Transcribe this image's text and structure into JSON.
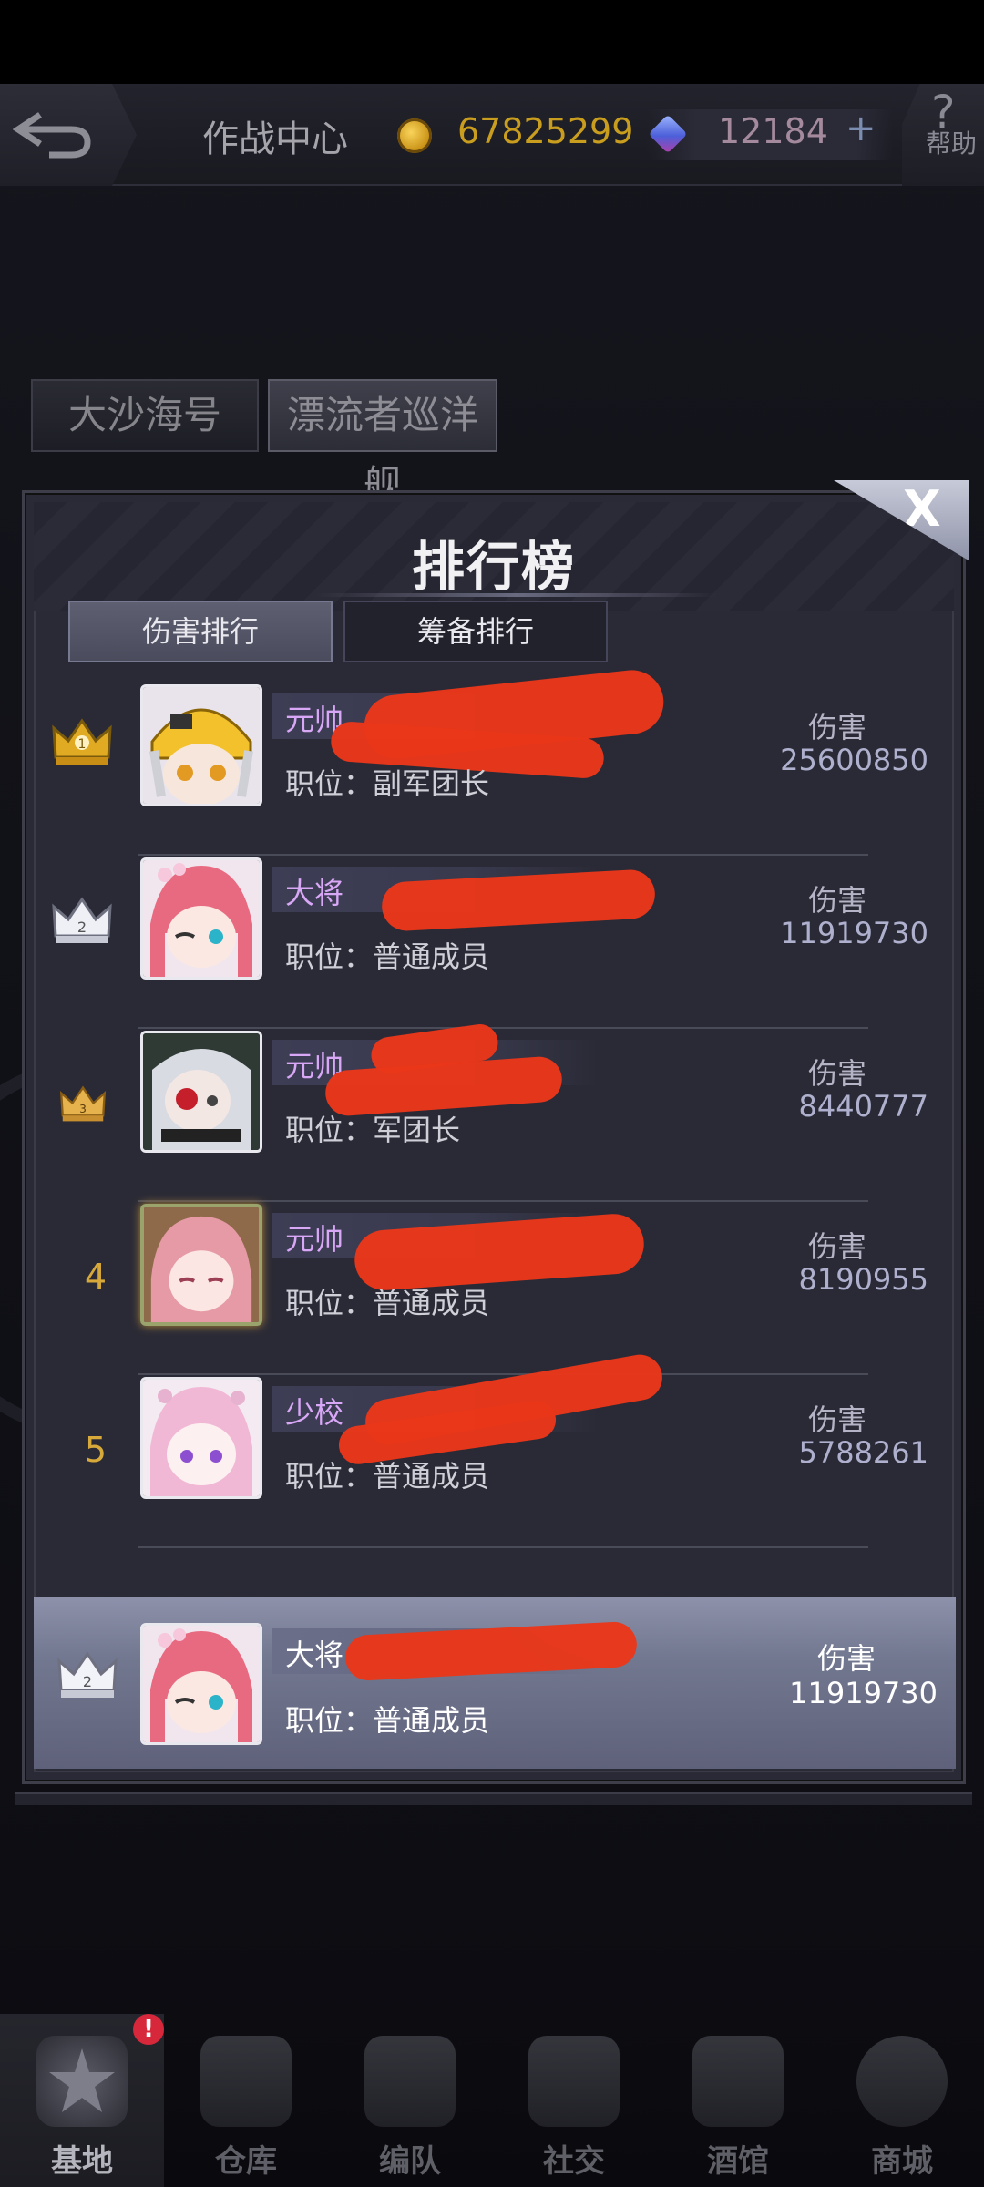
{
  "topbar": {
    "title": "作战中心",
    "gold": "67825299",
    "gems": "12184",
    "plus": "+",
    "help_q": "?",
    "help_label": "帮助"
  },
  "ship_tabs": [
    "大沙海号",
    "漂流者巡洋舰"
  ],
  "modal": {
    "title": "排行榜",
    "close": "X",
    "tabs": [
      "伤害排行",
      "筹备排行"
    ]
  },
  "rows": [
    {
      "rank": "1",
      "title": "元帅",
      "position_key": "职位：",
      "position": "副军团长",
      "dmg_label": "伤害",
      "dmg": "25600850"
    },
    {
      "rank": "2",
      "title": "大将",
      "position_key": "职位：",
      "position": "普通成员",
      "dmg_label": "伤害",
      "dmg": "11919730"
    },
    {
      "rank": "3",
      "title": "元帅",
      "position_key": "职位：",
      "position": "军团长",
      "dmg_label": "伤害",
      "dmg": "8440777"
    },
    {
      "rank": "4",
      "title": "元帅",
      "position_key": "职位：",
      "position": "普通成员",
      "dmg_label": "伤害",
      "dmg": "8190955"
    },
    {
      "rank": "5",
      "title": "少校",
      "position_key": "职位：",
      "position": "普通成员",
      "dmg_label": "伤害",
      "dmg": "5788261"
    }
  ],
  "self": {
    "rank": "2",
    "title": "大将",
    "position_key": "职位：",
    "position": "普通成员",
    "dmg_label": "伤害",
    "dmg": "11919730"
  },
  "nav": [
    {
      "label": "基地",
      "icon": "base-icon",
      "badge": "!"
    },
    {
      "label": "仓库",
      "icon": "warehouse-icon"
    },
    {
      "label": "编队",
      "icon": "formation-icon"
    },
    {
      "label": "社交",
      "icon": "handshake-icon"
    },
    {
      "label": "酒馆",
      "icon": "tavern-icon"
    },
    {
      "label": "商城",
      "icon": "shop-icon"
    }
  ],
  "colors": {
    "gold_text": "#c99d1e",
    "rank_title": "#d8a7f6",
    "redaction": "#e9371a",
    "rank_number": "#d6a93a"
  }
}
